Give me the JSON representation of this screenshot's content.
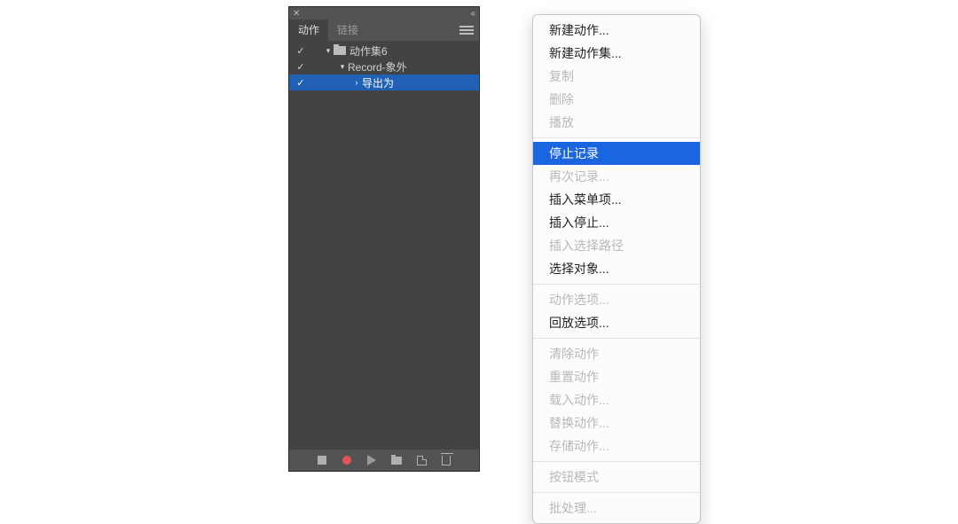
{
  "panel": {
    "tabs": {
      "actions": "动作",
      "links": "链接"
    },
    "tree": [
      {
        "check": "✓",
        "depth": 0,
        "disclosure": "▾",
        "folder": true,
        "label": "动作集6",
        "selected": false
      },
      {
        "check": "✓",
        "depth": 1,
        "disclosure": "▾",
        "folder": false,
        "label": "Record-象外",
        "selected": false
      },
      {
        "check": "✓",
        "depth": 2,
        "disclosure": "›",
        "folder": false,
        "label": "导出为",
        "selected": true
      }
    ]
  },
  "menu": {
    "groups": [
      [
        {
          "label": "新建动作...",
          "enabled": true,
          "highlight": false
        },
        {
          "label": "新建动作集...",
          "enabled": true,
          "highlight": false
        },
        {
          "label": "复制",
          "enabled": false,
          "highlight": false
        },
        {
          "label": "删除",
          "enabled": false,
          "highlight": false
        },
        {
          "label": "播放",
          "enabled": false,
          "highlight": false
        }
      ],
      [
        {
          "label": "停止记录",
          "enabled": true,
          "highlight": true
        },
        {
          "label": "再次记录...",
          "enabled": false,
          "highlight": false
        },
        {
          "label": "插入菜单项...",
          "enabled": true,
          "highlight": false
        },
        {
          "label": "插入停止...",
          "enabled": true,
          "highlight": false
        },
        {
          "label": "插入选择路径",
          "enabled": false,
          "highlight": false
        },
        {
          "label": "选择对象...",
          "enabled": true,
          "highlight": false
        }
      ],
      [
        {
          "label": "动作选项...",
          "enabled": false,
          "highlight": false
        },
        {
          "label": "回放选项...",
          "enabled": true,
          "highlight": false
        }
      ],
      [
        {
          "label": "清除动作",
          "enabled": false,
          "highlight": false
        },
        {
          "label": "重置动作",
          "enabled": false,
          "highlight": false
        },
        {
          "label": "载入动作...",
          "enabled": false,
          "highlight": false
        },
        {
          "label": "替换动作...",
          "enabled": false,
          "highlight": false
        },
        {
          "label": "存储动作...",
          "enabled": false,
          "highlight": false
        }
      ],
      [
        {
          "label": "按钮模式",
          "enabled": false,
          "highlight": false
        }
      ],
      [
        {
          "label": "批处理...",
          "enabled": false,
          "highlight": false
        }
      ]
    ]
  }
}
